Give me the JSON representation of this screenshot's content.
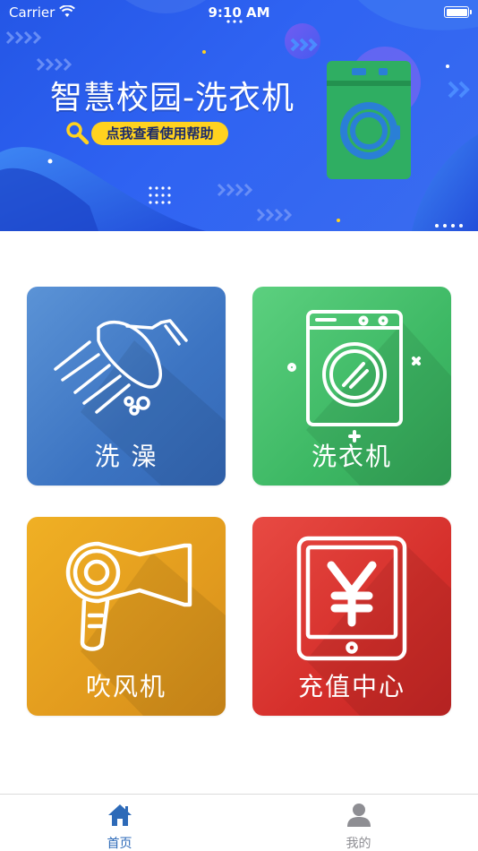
{
  "status_bar": {
    "carrier": "Carrier",
    "time": "9:10 AM"
  },
  "banner": {
    "title": "智慧校园-洗衣机",
    "help_label": "点我查看使用帮助"
  },
  "services": [
    {
      "label": "洗 澡",
      "icon": "shower-icon",
      "color": "#3f77c4"
    },
    {
      "label": "洗衣机",
      "icon": "washing-machine-icon",
      "color": "#3db864"
    },
    {
      "label": "吹风机",
      "icon": "hair-dryer-icon",
      "color": "#e29b1e"
    },
    {
      "label": "充值中心",
      "icon": "yen-tablet-icon",
      "color": "#d52f2b"
    }
  ],
  "tabbar": {
    "tabs": [
      {
        "label": "首页",
        "icon": "home-icon",
        "active": true,
        "color": "#2d6ab8"
      },
      {
        "label": "我的",
        "icon": "user-icon",
        "active": false,
        "color": "#8e8e93"
      }
    ]
  }
}
